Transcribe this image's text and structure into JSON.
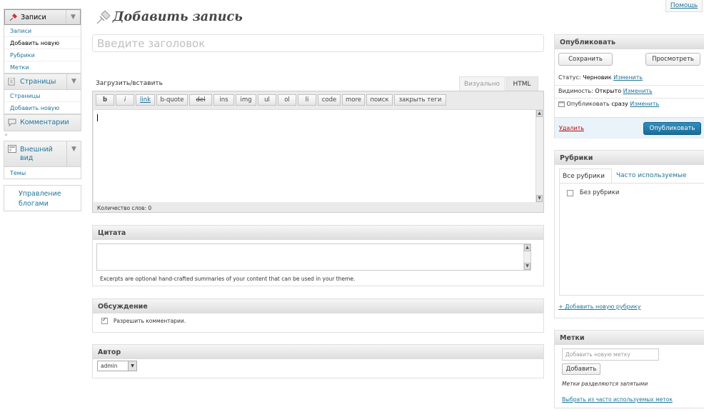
{
  "help_label": "Помощь",
  "page_title": "Добавить запись",
  "title_placeholder": "Введите заголовок",
  "menu": {
    "posts": {
      "label": "Записи",
      "items": [
        "Записи",
        "Добавить новую",
        "Рубрики",
        "Метки"
      ],
      "current_index": 1
    },
    "pages": {
      "label": "Страницы",
      "items": [
        "Страницы",
        "Добавить новую"
      ]
    },
    "comments": {
      "label": "Комментарии"
    },
    "appearance": {
      "label_line1": "Внешний",
      "label_line2": "вид",
      "items": [
        "Темы"
      ]
    },
    "manage_blogs": {
      "line1": "Управление",
      "line2": "блогами"
    }
  },
  "editor": {
    "upload_label": "Загрузить/вставить",
    "tab_visual": "Визуально",
    "tab_html": "HTML",
    "buttons": {
      "b": "b",
      "i": "i",
      "link": "link",
      "bquote": "b-quote",
      "del": "del",
      "ins": "ins",
      "img": "img",
      "ul": "ul",
      "ol": "ol",
      "li": "li",
      "code": "code",
      "more": "more",
      "search": "поиск",
      "close_tags": "закрыть теги"
    },
    "word_count": "Количество слов: 0"
  },
  "excerpt": {
    "title": "Цитата",
    "hint": "Excerpts are optional hand-crafted summaries of your content that can be used in your theme."
  },
  "discussion": {
    "title": "Обсуждение",
    "allow_comments_label": "Разрешить комментарии."
  },
  "author": {
    "title": "Автор",
    "selected": "admin"
  },
  "publish": {
    "title": "Опубликовать",
    "save_label": "Сохранить",
    "preview_label": "Просмотреть",
    "status_label": "Статус:",
    "status_value": "Черновик",
    "visibility_label": "Видимость:",
    "visibility_value": "Открыто",
    "schedule_label": "Опубликовать",
    "schedule_value": "сразу",
    "edit_link": "Изменить",
    "trash_label": "Удалить",
    "publish_label": "Опубликовать"
  },
  "categories": {
    "title": "Рубрики",
    "tab_all": "Все рубрики",
    "tab_popular": "Часто используемые",
    "items": [
      "Без рубрики"
    ],
    "add_link": "+ Добавить новую рубрику"
  },
  "tags": {
    "title": "Метки",
    "input_placeholder": "Добавить новую метку",
    "add_label": "Добавить",
    "note": "Метки разделяются запятыми",
    "choose_link": "Выбрать из часто используемых меток"
  },
  "colors": {
    "link": "#21759b",
    "primary_button": "#21759b",
    "trash": "#bc0b0b"
  }
}
